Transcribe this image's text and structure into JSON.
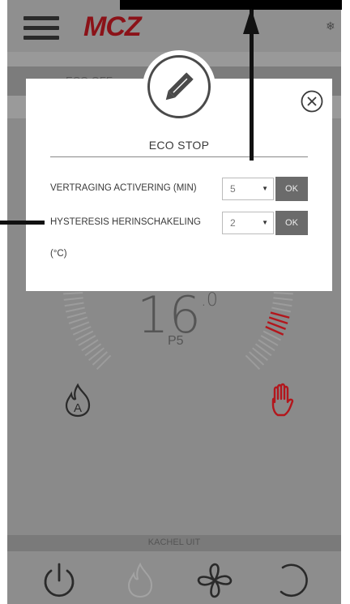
{
  "header": {
    "logo": "MCZ",
    "snow_icon": "❄"
  },
  "eco_bar": {
    "text": "ECO OFF"
  },
  "main": {
    "temperature_int": "16",
    "temperature_dec": ".0",
    "power_level": "P5"
  },
  "dialog": {
    "title": "ECO STOP",
    "rows": [
      {
        "label": "VERTRAGING ACTIVERING (MIN)",
        "value": "5",
        "ok": "OK"
      },
      {
        "label": "HYSTERESIS HERINSCHAKELING",
        "label2": "(°C)",
        "value": "2",
        "ok": "OK"
      }
    ]
  },
  "status": {
    "text": "KACHEL UIT"
  },
  "colors": {
    "brand": "#8b1218",
    "accent_red": "#b3161c",
    "overlay": "#8a8a8a"
  },
  "icons": [
    "menu-icon",
    "snowflake-icon",
    "pencil-icon",
    "close-circle-icon",
    "flame-auto-icon",
    "hand-icon",
    "power-icon",
    "flame-icon",
    "fan-icon",
    "reset-icon"
  ]
}
